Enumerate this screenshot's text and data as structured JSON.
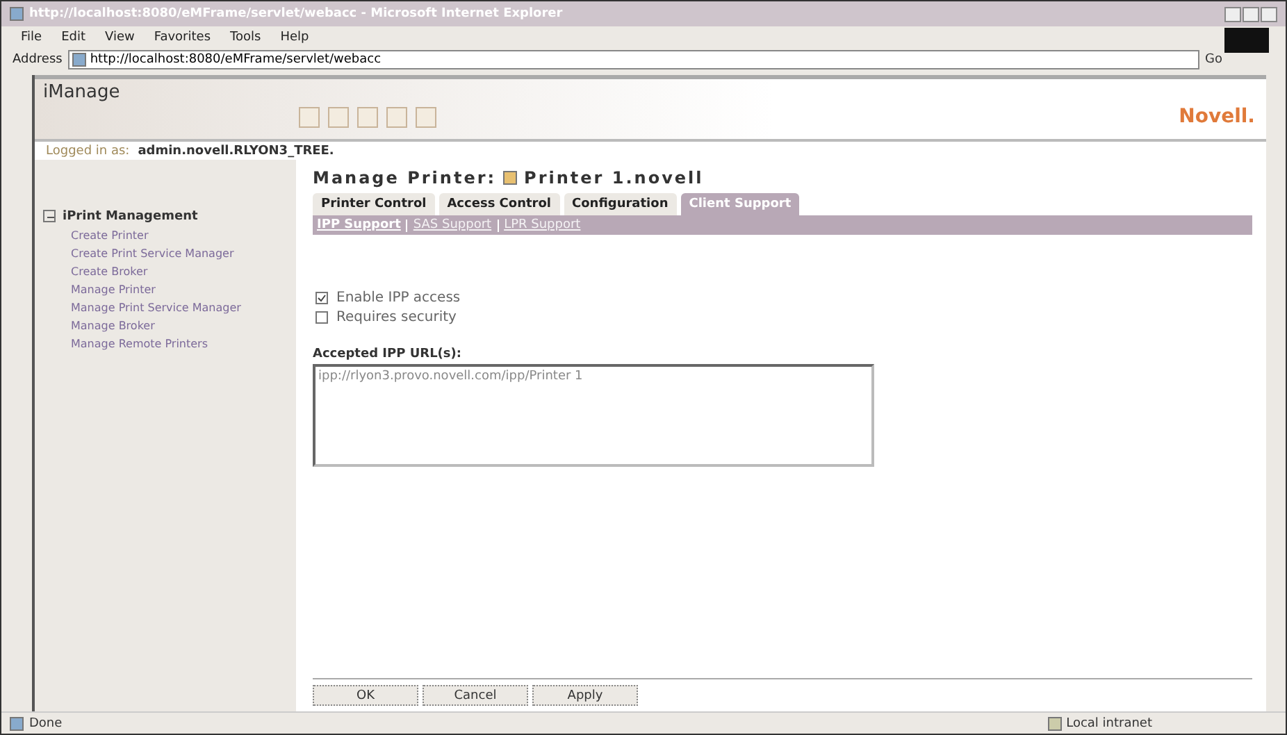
{
  "window": {
    "title": "http://localhost:8080/eMFrame/servlet/webacc - Microsoft Internet Explorer"
  },
  "menu": [
    "File",
    "Edit",
    "View",
    "Favorites",
    "Tools",
    "Help"
  ],
  "address": {
    "label": "Address",
    "value": "http://localhost:8080/eMFrame/servlet/webacc",
    "go": "Go"
  },
  "app": {
    "title": "iManage",
    "brand": "Novell."
  },
  "login": {
    "label": "Logged in as:",
    "user": "admin.novell.RLYON3_TREE."
  },
  "sidebar": {
    "group": "iPrint Management",
    "expanded": true,
    "items": [
      {
        "label": "Create Printer"
      },
      {
        "label": "Create Print Service Manager"
      },
      {
        "label": "Create Broker"
      },
      {
        "label": "Manage Printer"
      },
      {
        "label": "Manage Print Service Manager"
      },
      {
        "label": "Manage Broker"
      },
      {
        "label": "Manage Remote Printers"
      }
    ]
  },
  "heading": {
    "label": "Manage Printer:",
    "object": "Printer 1.novell"
  },
  "tabs": [
    {
      "label": "Printer Control",
      "selected": false
    },
    {
      "label": "Access Control",
      "selected": false
    },
    {
      "label": "Configuration",
      "selected": false
    },
    {
      "label": "Client Support",
      "selected": true
    }
  ],
  "subtabs": [
    {
      "label": "IPP Support",
      "selected": true
    },
    {
      "label": "SAS Support",
      "selected": false
    },
    {
      "label": "LPR Support",
      "selected": false
    }
  ],
  "options": [
    {
      "label": "Enable IPP access",
      "checked": true
    },
    {
      "label": "Requires security",
      "checked": false
    }
  ],
  "urls": {
    "label": "Accepted IPP URL(s):",
    "value": "ipp://rlyon3.provo.novell.com/ipp/Printer 1"
  },
  "buttons": [
    "OK",
    "Cancel",
    "Apply"
  ],
  "status_bar": {
    "text": "Done",
    "zone": "Local intranet"
  }
}
